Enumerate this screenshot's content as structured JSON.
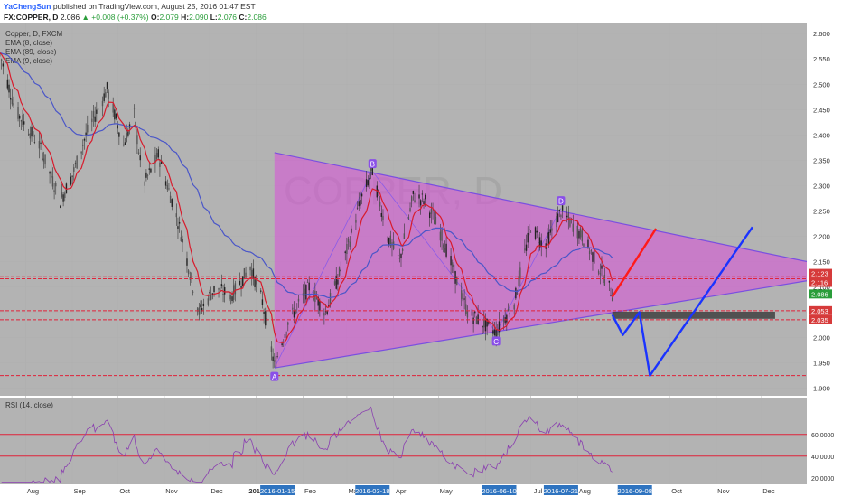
{
  "header": {
    "author": "YaChengSun",
    "published": "published on TradingView.com, August 25, 2016 01:47 EST",
    "symbol": "FX:COPPER, D",
    "last": "2.086",
    "change": "+0.008 (+0.37%)",
    "open": "2.079",
    "high": "2.090",
    "low": "2.076",
    "close": "2.086"
  },
  "chart_data": {
    "type": "line",
    "title": "Copper, D, FXCM",
    "watermark": "COPPER, D",
    "indicators": [
      "EMA (8, close)",
      "EMA (89, close)",
      "EMA (9, close)"
    ],
    "price_axis": {
      "ylim": [
        1.885,
        2.62
      ],
      "ticks": [
        "1.900",
        "1.950",
        "2.000",
        "2.050",
        "2.100",
        "2.150",
        "2.200",
        "2.250",
        "2.300",
        "2.350",
        "2.400",
        "2.450",
        "2.500",
        "2.550",
        "2.600"
      ]
    },
    "price_tags": [
      {
        "value": 2.123,
        "label": "2.123",
        "color": "#d63a3a"
      },
      {
        "value": 2.116,
        "label": "2.116",
        "color": "#d63a3a"
      },
      {
        "value": 2.086,
        "label": "2.086",
        "color": "#2a9d3a"
      },
      {
        "value": 2.053,
        "label": "2.053",
        "color": "#d63a3a"
      },
      {
        "value": 2.035,
        "label": "2.035",
        "color": "#d63a3a"
      }
    ],
    "horizontal_levels": [
      2.12,
      2.116,
      2.053,
      2.035,
      1.925
    ],
    "support_zone": [
      2.037,
      2.051
    ],
    "time_axis": {
      "months": [
        "Aug",
        "Sep",
        "Oct",
        "Nov",
        "Dec",
        "2016",
        "Feb",
        "Mar",
        "Apr",
        "May",
        "Jun",
        "Jul",
        "Aug",
        "Oct",
        "Nov",
        "Dec"
      ],
      "date_tags": [
        "2016-01-15",
        "2016-03-18",
        "2016-06-10",
        "2016-07-21",
        "2016-09-08"
      ]
    },
    "pattern_points": [
      {
        "name": "A",
        "date": "2016-01-13",
        "value": 1.94
      },
      {
        "name": "B",
        "date": "2016-03-18",
        "value": 2.328
      },
      {
        "name": "C",
        "date": "2016-06-08",
        "value": 2.01
      },
      {
        "name": "D",
        "date": "2016-07-21",
        "value": 2.255
      }
    ],
    "triangle": {
      "resistance": [
        [
          "2016-01-13",
          2.365
        ],
        [
          "2016-12-31",
          2.15
        ]
      ],
      "support": [
        [
          "2016-01-13",
          1.94
        ],
        [
          "2016-12-31",
          2.112
        ]
      ]
    },
    "projection_red": [
      [
        "2016-08-24",
        2.08
      ],
      [
        "2016-09-22",
        2.215
      ]
    ],
    "projection_blue": [
      [
        "2016-08-24",
        2.045
      ],
      [
        "2016-08-31",
        2.005
      ],
      [
        "2016-09-11",
        2.05
      ],
      [
        "2016-09-18",
        1.925
      ],
      [
        "2016-11-25",
        2.218
      ]
    ],
    "colors": {
      "triangle_fill": "#d84fd8",
      "ema_fast": "#d81b2c",
      "ema_slow": "#4a56c8",
      "level": "#e0233a",
      "projection_red": "#ff1a1a",
      "projection_blue": "#1a33ff",
      "grid": "#b0b0b0"
    },
    "rsi": {
      "title": "RSI (14, close)",
      "ylim": [
        14,
        94
      ],
      "levels": [
        40,
        60
      ],
      "ticks": [
        "20.0000",
        "40.0000",
        "60.0000"
      ]
    }
  }
}
